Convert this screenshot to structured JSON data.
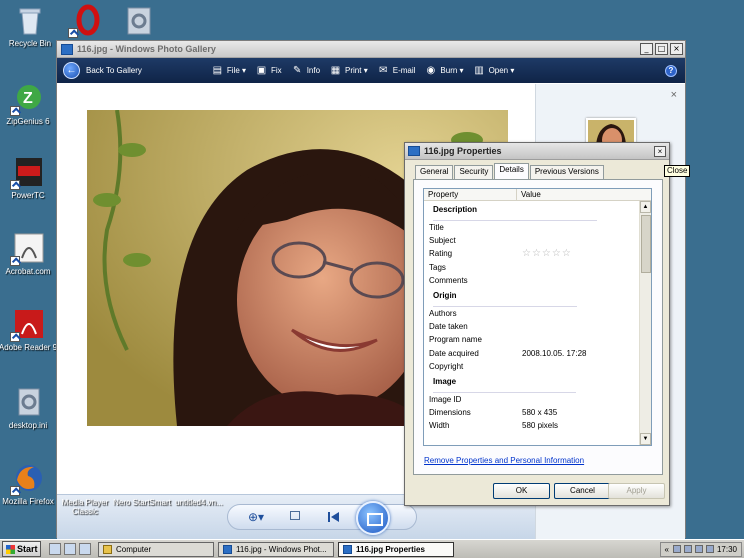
{
  "desktop": {
    "icons": [
      {
        "label": "Recycle Bin"
      },
      {
        "label": "ZipGenius 6"
      },
      {
        "label": "PowerTC"
      },
      {
        "label": "Acrobat.com"
      },
      {
        "label": "Adobe Reader 9"
      },
      {
        "label": "desktop.ini"
      },
      {
        "label": "Mozilla Firefox"
      },
      {
        "label": "Media Player Classic"
      },
      {
        "label": "Nero StartSmart"
      },
      {
        "label": "untitled4.vn..."
      }
    ]
  },
  "gallery": {
    "title": "116.jpg - Windows Photo Gallery",
    "toolbar": {
      "back": "Back To Gallery",
      "file": "File",
      "fix": "Fix",
      "info": "Info",
      "print": "Print",
      "email": "E-mail",
      "burn": "Burn",
      "open": "Open"
    },
    "side_close": "×"
  },
  "properties": {
    "title": "116.jpg Properties",
    "tooltip": "Close",
    "tabs": [
      "General",
      "Security",
      "Details",
      "Previous Versions"
    ],
    "active_tab": "Details",
    "columns": {
      "property": "Property",
      "value": "Value"
    },
    "sections": {
      "description": "Description",
      "origin": "Origin",
      "image": "Image"
    },
    "rows": {
      "title": "Title",
      "subject": "Subject",
      "rating": "Rating",
      "rating_stars": "☆☆☆☆☆",
      "tags": "Tags",
      "comments": "Comments",
      "authors": "Authors",
      "date_taken": "Date taken",
      "program_name": "Program name",
      "date_acquired": "Date acquired",
      "date_acquired_value": "2008.10.05. 17:28",
      "copyright": "Copyright",
      "image_id": "Image ID",
      "dimensions": "Dimensions",
      "dimensions_value": "580 x 435",
      "width": "Width",
      "width_value": "580 pixels"
    },
    "link": "Remove Properties and Personal Information",
    "buttons": {
      "ok": "OK",
      "cancel": "Cancel",
      "apply": "Apply"
    }
  },
  "taskbar": {
    "start": "Start",
    "tasks": [
      "Computer",
      "116.jpg - Windows Phot...",
      "116.jpg Properties"
    ],
    "tray_arrows": "«",
    "clock": "17:30"
  }
}
